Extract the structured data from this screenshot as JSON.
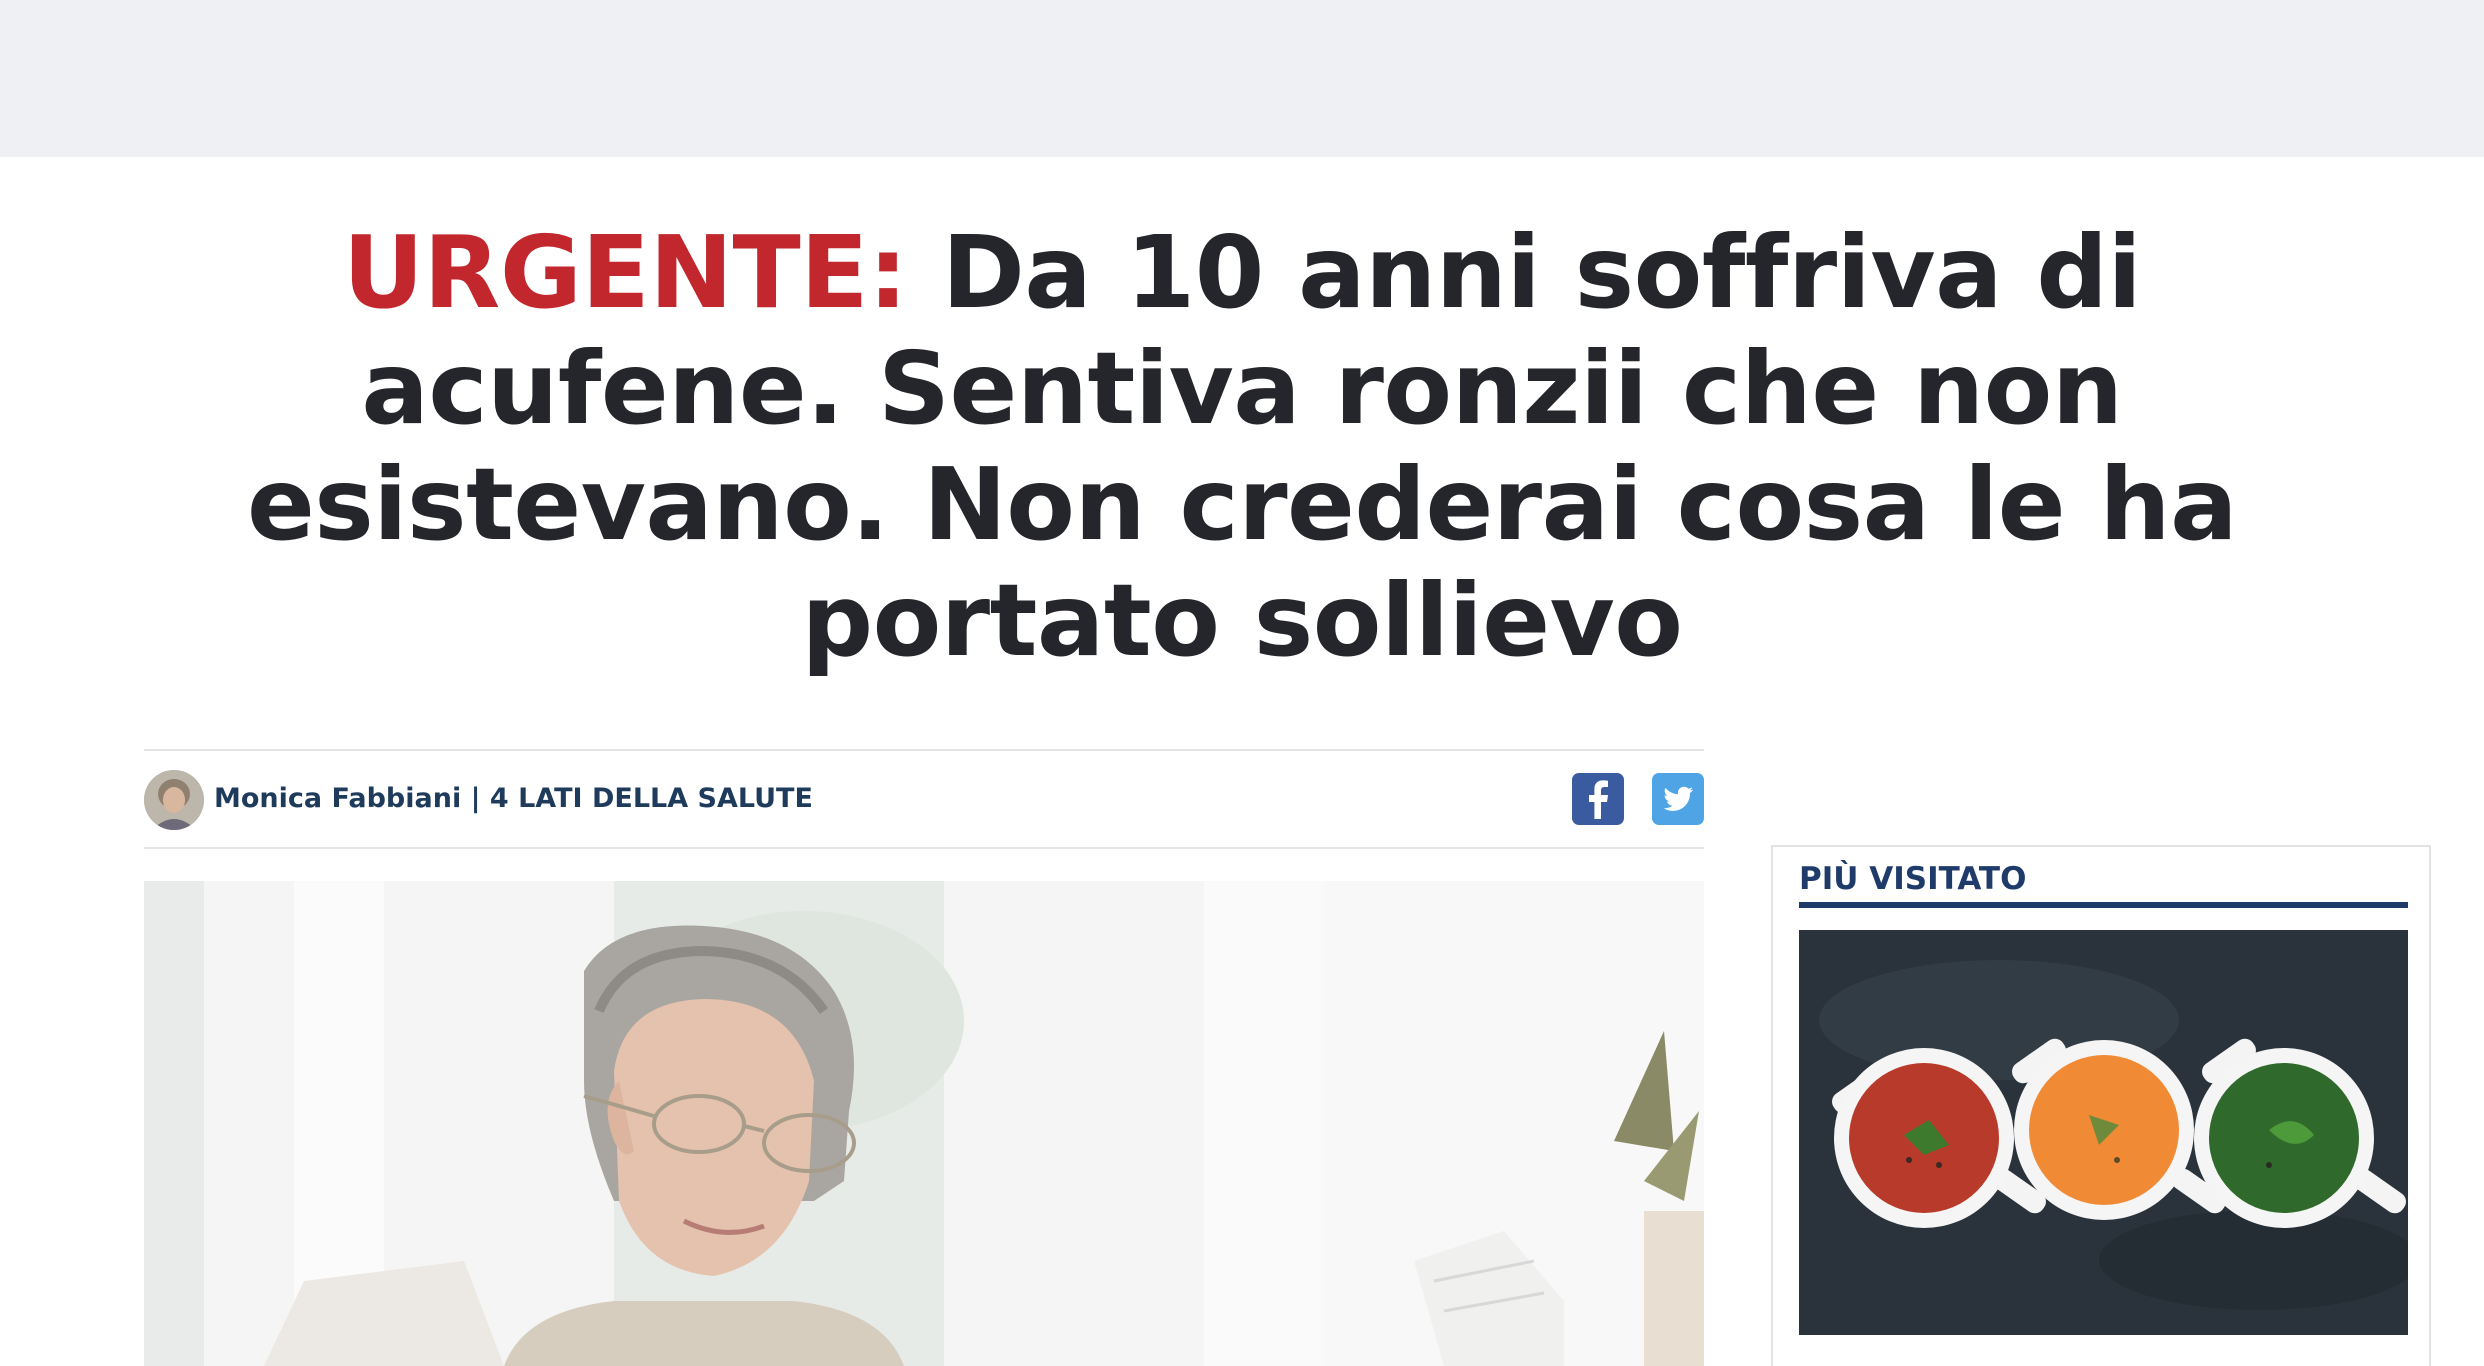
{
  "article": {
    "headline_prefix": "URGENTE:",
    "headline_text": "Da 10 anni soffriva di acufene. Sentiva ronzii che non esistevano. Non crederai cosa le ha portato sollievo",
    "author": "Monica Fabbiani",
    "separator": "|",
    "publication": "4 LATI DELLA SALUTE"
  },
  "share": {
    "facebook_icon": "facebook-icon",
    "twitter_icon": "twitter-icon"
  },
  "sidebar": {
    "title": "PIÙ VISITATO"
  },
  "colors": {
    "urgent": "#c1272d",
    "headline": "#24262b",
    "byline": "#1f3b5c",
    "sidebar_accent": "#1f3b6a",
    "facebook": "#3b5ba0",
    "twitter": "#4fa4e6",
    "top_band": "#eff0f3"
  }
}
